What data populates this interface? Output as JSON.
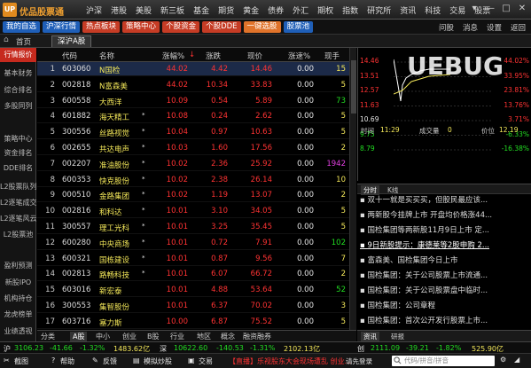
{
  "app": {
    "title": "优品股票通",
    "logo": "UP",
    "nav": [
      "沪深",
      "港股",
      "美股",
      "新三板",
      "基金",
      "期货",
      "黄金",
      "债券",
      "外汇",
      "期权",
      "指数",
      "研究所",
      "资讯",
      "科技",
      "交易",
      "股票"
    ],
    "window_buttons": [
      "▾",
      "—",
      "□",
      "✕"
    ]
  },
  "toolbar": {
    "buttons": [
      {
        "label": "我的自选",
        "color": "blue"
      },
      {
        "label": "沪深行情",
        "color": "blue"
      },
      {
        "label": "热点板块",
        "color": "red"
      },
      {
        "label": "策略中心",
        "color": "red"
      },
      {
        "label": "个股资金",
        "color": "red"
      },
      {
        "label": "个股DDE",
        "color": "red"
      },
      {
        "label": "一键选股",
        "color": "orange"
      },
      {
        "label": "股票池",
        "color": "blue"
      }
    ],
    "right": [
      "问股",
      "消息",
      "设置",
      "返回"
    ]
  },
  "tabs": {
    "home": "首页",
    "active": "深沪A股"
  },
  "sidebar": {
    "items": [
      "行情报价",
      "基本财务",
      "综合排名",
      "多股同列",
      "策略中心",
      "资金排名",
      "DDE排名",
      "L2股票队列",
      "L2逐笔成交",
      "L2逐笔风云",
      "L2股票池",
      "盈利预测",
      "新股IPO",
      "机构持仓",
      "龙虎榜单",
      "业绩透视"
    ],
    "active_index": 0
  },
  "table": {
    "headers": [
      "代码",
      "名称",
      "涨幅%",
      "涨跌",
      "现价",
      "涨速%",
      "现手"
    ],
    "rows": [
      {
        "idx": "1",
        "code": "603060",
        "name": "N国检",
        "star": "",
        "pct": "44.02",
        "chg": "4.42",
        "price": "14.46",
        "speed": "0.00",
        "vol": "15",
        "pc": "red",
        "sc": "white",
        "vc": "yellow"
      },
      {
        "idx": "2",
        "code": "002818",
        "name": "N富森美",
        "star": "",
        "pct": "44.02",
        "chg": "10.34",
        "price": "33.83",
        "speed": "0.00",
        "vol": "5",
        "pc": "red",
        "sc": "white",
        "vc": "yellow"
      },
      {
        "idx": "3",
        "code": "600558",
        "name": "大西洋",
        "star": "",
        "pct": "10.09",
        "chg": "0.54",
        "price": "5.89",
        "speed": "0.00",
        "vol": "73",
        "pc": "red",
        "sc": "white",
        "vc": "green"
      },
      {
        "idx": "4",
        "code": "601882",
        "name": "海天精工",
        "star": "*",
        "pct": "10.08",
        "chg": "0.24",
        "price": "2.62",
        "speed": "0.00",
        "vol": "5",
        "pc": "red",
        "sc": "white",
        "vc": "yellow"
      },
      {
        "idx": "5",
        "code": "300556",
        "name": "丝路视觉",
        "star": "*",
        "pct": "10.04",
        "chg": "0.97",
        "price": "10.63",
        "speed": "0.00",
        "vol": "5",
        "pc": "red",
        "sc": "white",
        "vc": "yellow"
      },
      {
        "idx": "6",
        "code": "002655",
        "name": "共达电声",
        "star": "*",
        "pct": "10.03",
        "chg": "1.60",
        "price": "17.56",
        "speed": "0.00",
        "vol": "2",
        "pc": "red",
        "sc": "white",
        "vc": "yellow"
      },
      {
        "idx": "7",
        "code": "002207",
        "name": "准油股份",
        "star": "*",
        "pct": "10.02",
        "chg": "2.36",
        "price": "25.92",
        "speed": "0.00",
        "vol": "1942",
        "pc": "red",
        "sc": "white",
        "vc": "magenta"
      },
      {
        "idx": "8",
        "code": "600353",
        "name": "快克股份",
        "star": "*",
        "pct": "10.02",
        "chg": "2.38",
        "price": "26.14",
        "speed": "0.00",
        "vol": "10",
        "pc": "red",
        "sc": "white",
        "vc": "yellow"
      },
      {
        "idx": "9",
        "code": "000510",
        "name": "金路集团",
        "star": "*",
        "pct": "10.02",
        "chg": "1.19",
        "price": "13.07",
        "speed": "0.00",
        "vol": "2",
        "pc": "red",
        "sc": "white",
        "vc": "yellow"
      },
      {
        "idx": "10",
        "code": "002816",
        "name": "和科达",
        "star": "*",
        "pct": "10.01",
        "chg": "3.10",
        "price": "34.05",
        "speed": "0.00",
        "vol": "5",
        "pc": "red",
        "sc": "white",
        "vc": "yellow"
      },
      {
        "idx": "11",
        "code": "300557",
        "name": "理工光科",
        "star": "*",
        "pct": "10.01",
        "chg": "3.25",
        "price": "35.45",
        "speed": "0.00",
        "vol": "5",
        "pc": "red",
        "sc": "white",
        "vc": "yellow"
      },
      {
        "idx": "12",
        "code": "600280",
        "name": "中央商场",
        "star": "*",
        "pct": "10.01",
        "chg": "0.72",
        "price": "7.91",
        "speed": "0.00",
        "vol": "102",
        "pc": "red",
        "sc": "white",
        "vc": "green"
      },
      {
        "idx": "13",
        "code": "600321",
        "name": "国栋建设",
        "star": "*",
        "pct": "10.01",
        "chg": "0.87",
        "price": "9.56",
        "speed": "0.00",
        "vol": "7",
        "pc": "red",
        "sc": "white",
        "vc": "yellow"
      },
      {
        "idx": "14",
        "code": "002813",
        "name": "路畅科技",
        "star": "*",
        "pct": "10.01",
        "chg": "6.07",
        "price": "66.72",
        "speed": "0.00",
        "vol": "2",
        "pc": "red",
        "sc": "white",
        "vc": "yellow"
      },
      {
        "idx": "15",
        "code": "603016",
        "name": "新宏泰",
        "star": "",
        "pct": "10.01",
        "chg": "4.88",
        "price": "53.64",
        "speed": "0.00",
        "vol": "52",
        "pc": "red",
        "sc": "white",
        "vc": "green"
      },
      {
        "idx": "16",
        "code": "300553",
        "name": "集智股份",
        "star": "",
        "pct": "10.01",
        "chg": "6.37",
        "price": "70.02",
        "speed": "0.00",
        "vol": "3",
        "pc": "red",
        "sc": "white",
        "vc": "yellow"
      },
      {
        "idx": "17",
        "code": "603716",
        "name": "塞力斯",
        "star": "",
        "pct": "10.00",
        "chg": "6.87",
        "price": "75.52",
        "speed": "0.00",
        "vol": "5",
        "pc": "red",
        "sc": "white",
        "vc": "yellow"
      }
    ]
  },
  "grid_tabs": [
    "分类",
    "A股",
    "中小",
    "创业",
    "B股",
    "行业",
    "地区",
    "概念",
    "融资融券"
  ],
  "chart": {
    "left_prices": [
      "14.46",
      "13.51",
      "12.57",
      "11.63",
      "10.69",
      "9.75",
      "8.79"
    ],
    "right_pcts": [
      "44.02%",
      "33.95%",
      "23.81%",
      "13.76%",
      "3.71%",
      "-6.33%",
      "-16.38%"
    ],
    "time_label": "时间",
    "time_value": "11:29",
    "vol_label": "成交量",
    "vol_value": "0",
    "price_label": "价位",
    "price_value": "12.19"
  },
  "news_tabs1": [
    "分时",
    "K线"
  ],
  "news": [
    {
      "text": "双十一就是买买买，但股民最应该...",
      "hl": false
    },
    {
      "text": "两新股今挂牌上市 开盘均价格涨44...",
      "hl": false
    },
    {
      "text": "国检集团等两新股11月9日上市 定...",
      "hl": false
    },
    {
      "text": "9日新股提示：康德莱等2股申购 2...",
      "hl": true
    },
    {
      "text": "富森美、国检集团今日上市",
      "hl": false
    },
    {
      "text": "国检集团：关于公司股票上市流通...",
      "hl": false
    },
    {
      "text": "国检集团：关于公司股票盘中临时...",
      "hl": false
    },
    {
      "text": "国检集团：公司章程",
      "hl": false
    },
    {
      "text": "国检集团：首次公开发行股票上市...",
      "hl": false
    }
  ],
  "news_tabs2": [
    "资讯",
    "研报"
  ],
  "status": {
    "sh_label": "沪",
    "sh_index": "3106.23",
    "sh_chg": "-41.66",
    "sh_pct": "-1.32%",
    "sh_amt": "1483.62亿",
    "sz_label": "深",
    "sz_index": "10622.60",
    "sz_chg": "-140.53",
    "sz_pct": "-1.31%",
    "sz_amt": "2102.13亿",
    "cy_label": "创",
    "cy_index": "2111.09",
    "cy_chg": "-39.21",
    "cy_pct": "-1.82%",
    "cy_amt": "525.90亿"
  },
  "bottom": {
    "items": [
      "截图",
      "帮助",
      "反馈",
      "模拟炒股",
      "交易"
    ],
    "ticker": "【直播】乐视股东大会现场遭乱 创业...",
    "user": "请先登录",
    "search_placeholder": "代码/拼音/拼音"
  },
  "watermark": "UEBUG.com"
}
